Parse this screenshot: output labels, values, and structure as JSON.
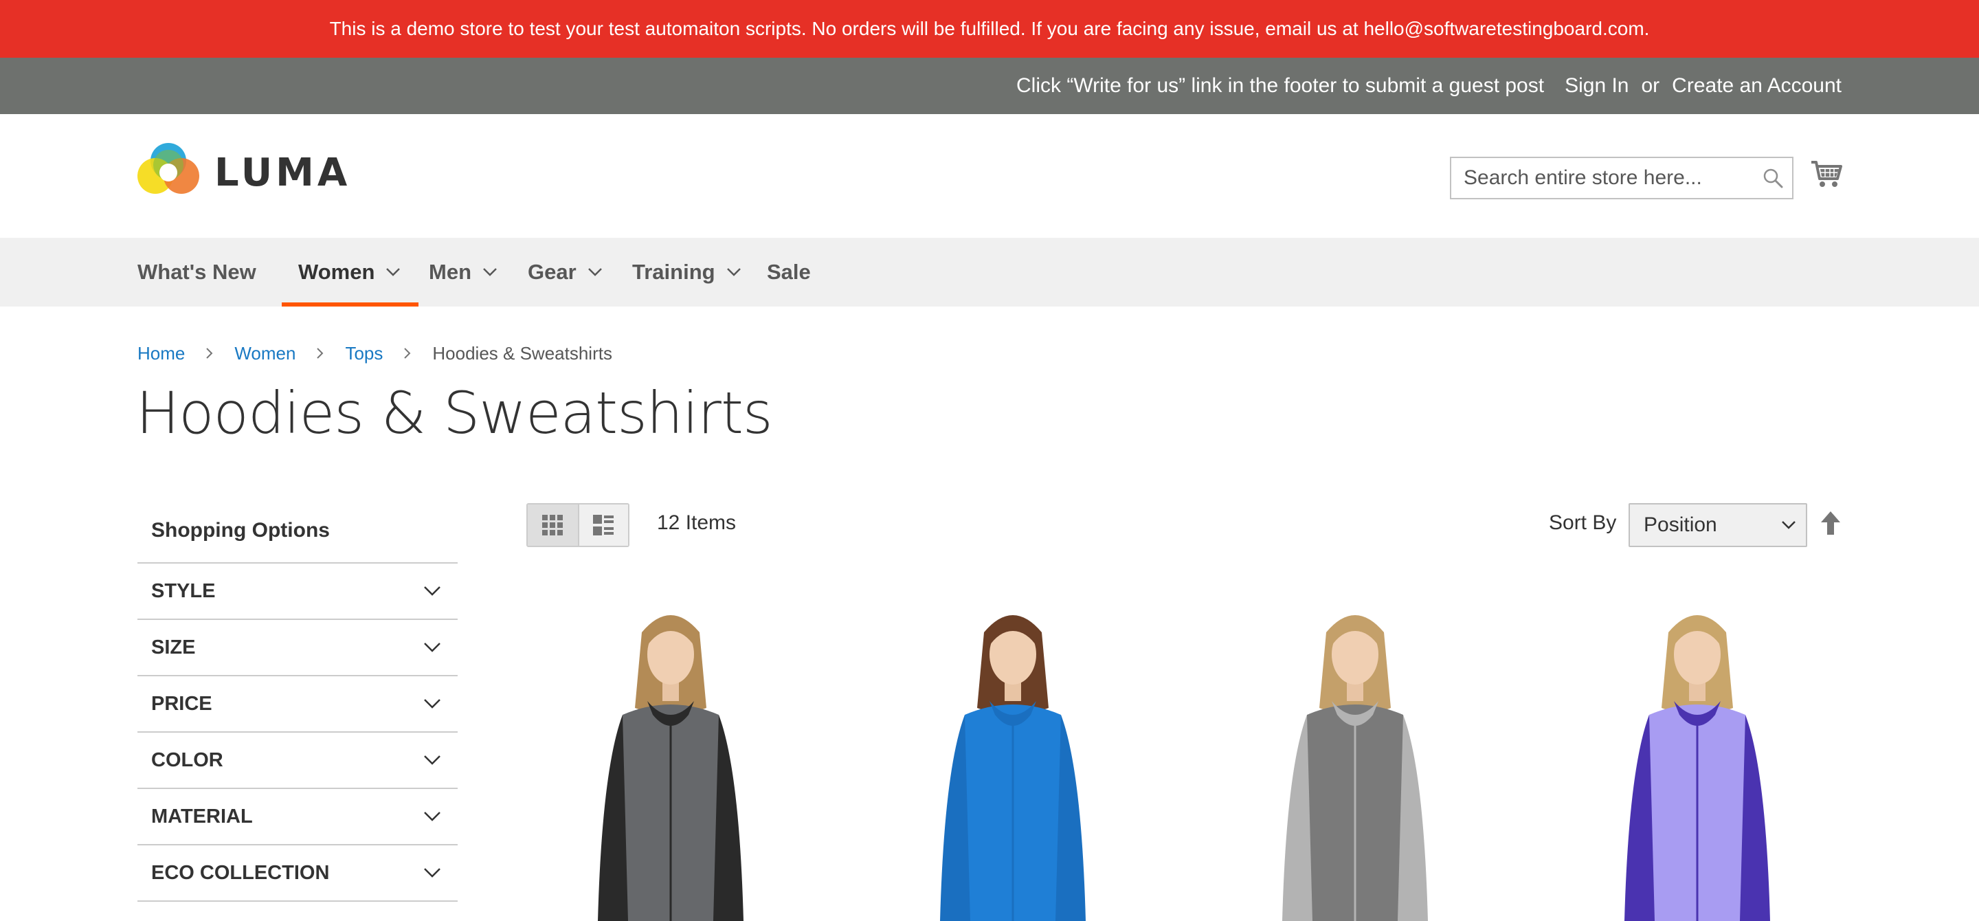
{
  "notice": {
    "text": "This is a demo store to test your test automaiton scripts. No orders will be fulfilled. If you are facing any issue, email us at hello@softwaretestingboard.com."
  },
  "top_bar": {
    "guest_post": "Click “Write for us” link in the footer to submit a guest post",
    "sign_in": "Sign In",
    "or": "or",
    "create_account": "Create an Account"
  },
  "header": {
    "logo_text": "LUMA",
    "search_placeholder": "Search entire store here..."
  },
  "nav": {
    "items": [
      {
        "label": "What's New"
      },
      {
        "label": "Women"
      },
      {
        "label": "Men"
      },
      {
        "label": "Gear"
      },
      {
        "label": "Training"
      },
      {
        "label": "Sale"
      }
    ]
  },
  "breadcrumb": [
    "Home",
    "Women",
    "Tops",
    "Hoodies & Sweatshirts"
  ],
  "page_title": "Hoodies & Sweatshirts",
  "sidebar": {
    "title": "Shopping Options",
    "filters": [
      "STYLE",
      "SIZE",
      "PRICE",
      "COLOR",
      "MATERIAL",
      "ECO COLLECTION"
    ]
  },
  "toolbar": {
    "items_count": "12 Items",
    "sort_label": "Sort By",
    "sort_value": "Position"
  },
  "products": [
    {
      "hoodie": "#66686b",
      "trim": "#2a2a2a",
      "hair": "#b38b56",
      "pants": "#1e1e1e"
    },
    {
      "hoodie": "#1f7fd6",
      "trim": "#1a6fc0",
      "hair": "#6b3f26",
      "pants": "#a8a8a8"
    },
    {
      "hoodie": "#7a7a7a",
      "trim": "#b3b3b3",
      "hair": "#c4a06a",
      "pants": "#6a7fd0"
    },
    {
      "hoodie": "#a89cf2",
      "trim": "#4a33b0",
      "hair": "#c9a66b",
      "pants": "#555555"
    }
  ],
  "colors": {
    "notice_bg": "#e63026",
    "top_bar_bg": "#6e716e",
    "nav_bg": "#f0f0f0",
    "nav_active_underline": "#ff5501",
    "link": "#1979c3"
  }
}
